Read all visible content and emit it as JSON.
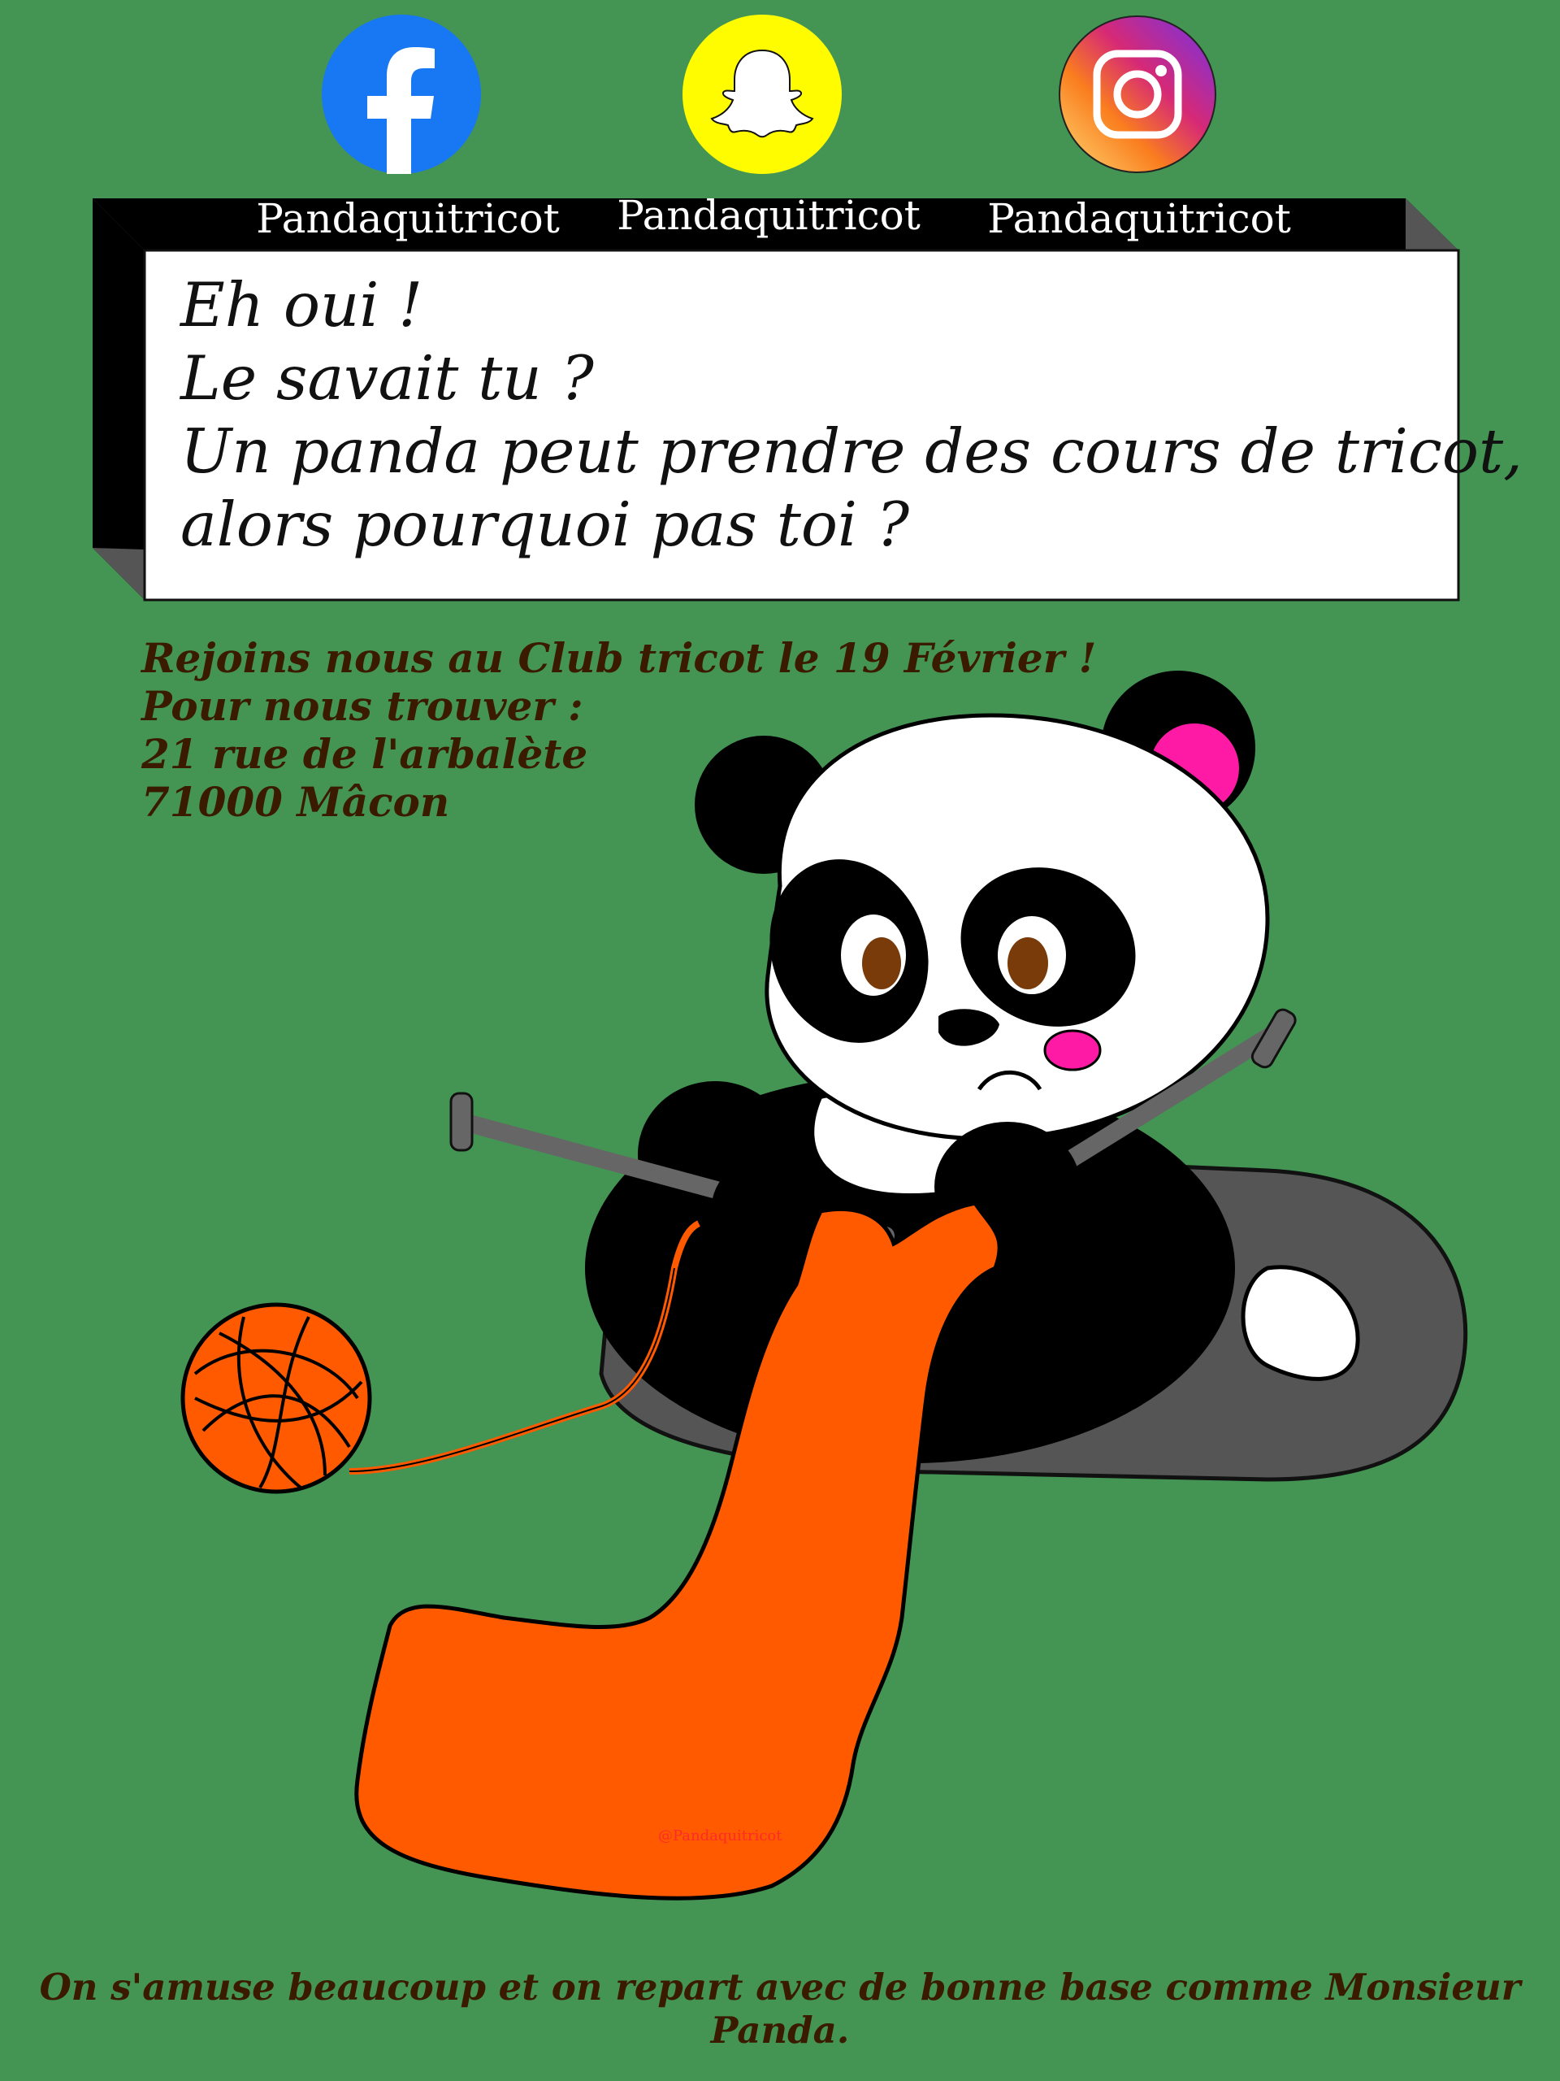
{
  "social": [
    {
      "network": "facebook",
      "icon": "facebook-icon",
      "handle": "Pandaquitricot",
      "color": "#1877f2"
    },
    {
      "network": "snapchat",
      "icon": "snapchat-ghost-icon",
      "handle": "Pandaquitricot",
      "color": "#fffc00"
    },
    {
      "network": "instagram",
      "icon": "instagram-icon",
      "handle": "Pandaquitricot",
      "color": "#d6249f"
    }
  ],
  "headline": {
    "line1": "Eh oui !",
    "line2": "Le savait tu ?",
    "line3": "Un panda peut prendre des cours de tricot,",
    "line4": "alors pourquoi pas toi ?"
  },
  "info": {
    "line1": "Rejoins nous au Club tricot le 19 Février !",
    "line2": "Pour nous trouver :",
    "line3": "21 rue de l'arbalète",
    "line4": "71000 Mâcon"
  },
  "watermark": "@Pandaquitricot",
  "footer": "On s'amuse beaucoup et on repart avec de bonne base comme Monsieur Panda.",
  "colors": {
    "background": "#449554",
    "highlight_orange": "#ff7a00",
    "highlight_pink": "#e4007c",
    "knit_orange": "#ff5a00",
    "text_brown": "#3a1a00"
  }
}
